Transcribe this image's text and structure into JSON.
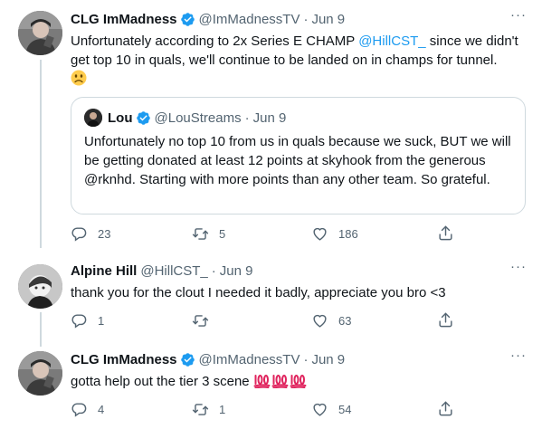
{
  "tweets": [
    {
      "name": "CLG ImMadness",
      "verified": true,
      "handle": "@ImMadnessTV",
      "separator": "·",
      "date": "Jun 9",
      "text_part1": "Unfortunately according to 2x Series E CHAMP ",
      "mention": "@HillCST_",
      "text_part2": " since we didn't get top 10 in quals, we'll continue to be landed on in champs for tunnel.",
      "emoji": "slightly-frowning-face",
      "quote": {
        "name": "Lou",
        "verified": true,
        "handle": "@LouStreams",
        "separator": "·",
        "date": "Jun 9",
        "text": "Unfortunately no top 10 from us in quals because we suck, BUT we will be getting donated at least 12 points at skyhook from the generous @rknhd. Starting with more points than any other team. So grateful."
      },
      "replies": "23",
      "retweets": "5",
      "likes": "186"
    },
    {
      "name": "Alpine Hill",
      "verified": false,
      "handle": "@HillCST_",
      "separator": "·",
      "date": "Jun 9",
      "text": "thank you for the clout I needed it badly, appreciate you bro <3",
      "replies": "1",
      "retweets": "",
      "likes": "63"
    },
    {
      "name": "CLG ImMadness",
      "verified": true,
      "handle": "@ImMadnessTV",
      "separator": "·",
      "date": "Jun 9",
      "text": "gotta help out the tier 3 scene ",
      "emoji": "hundred-points x3",
      "replies": "4",
      "retweets": "1",
      "likes": "54"
    }
  ],
  "icons": {
    "reply": "reply-icon",
    "retweet": "retweet-icon",
    "like": "heart-icon",
    "share": "share-icon",
    "more": "more-icon",
    "verified": "verified-badge-icon"
  },
  "colors": {
    "accent": "#1d9bf0",
    "secondary_text": "#536471",
    "border": "#cfd9de",
    "hundred_emoji": "#e0245e"
  }
}
